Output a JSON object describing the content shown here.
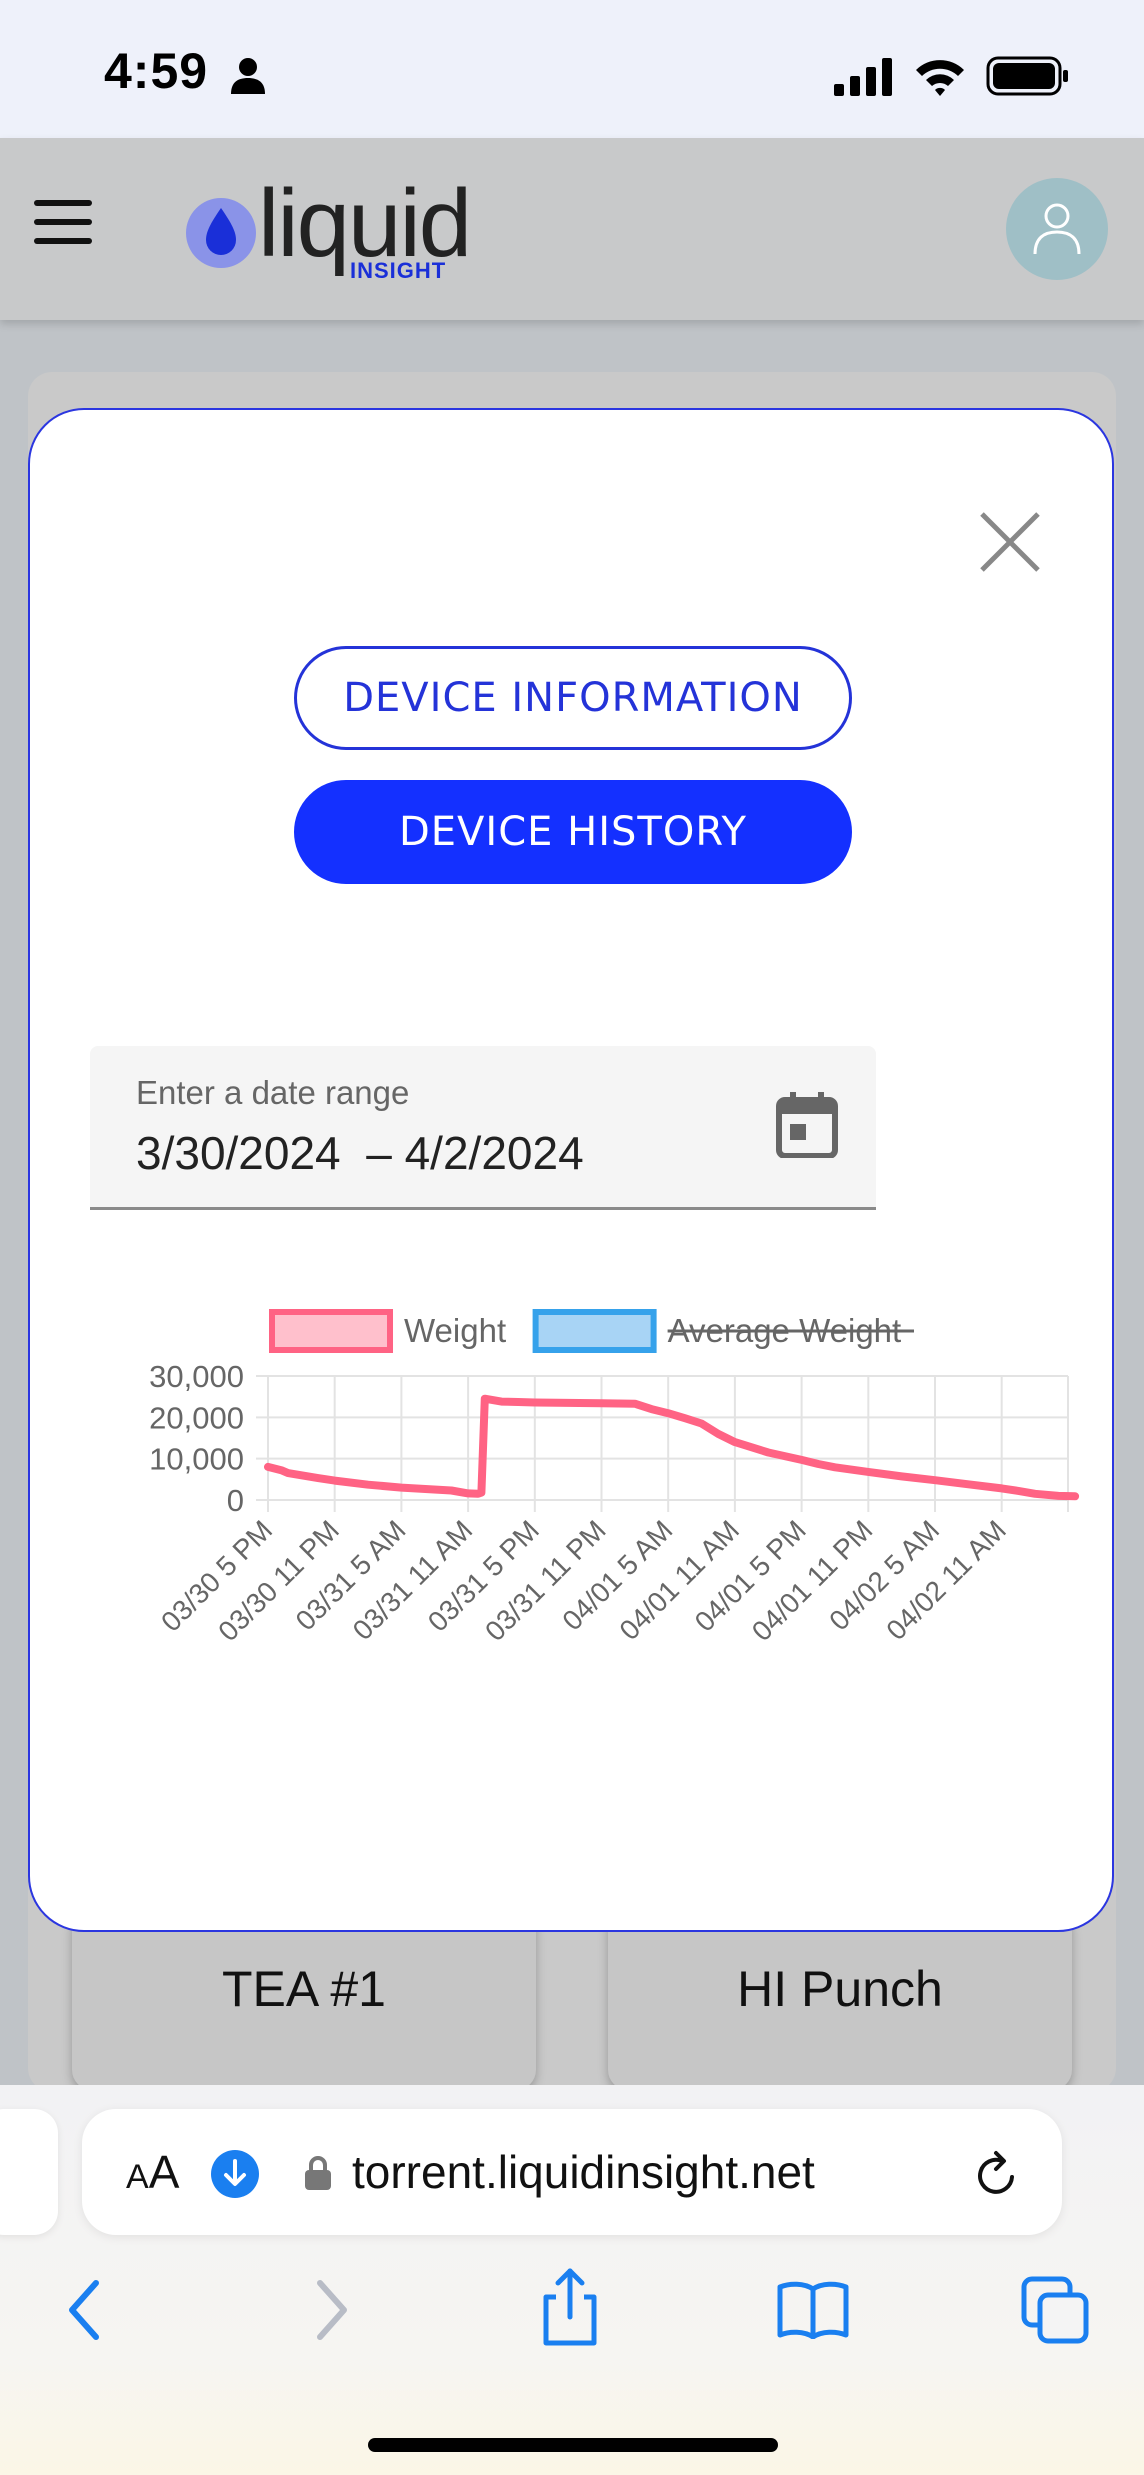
{
  "status_bar": {
    "time": "4:59"
  },
  "header": {
    "logo_word": "liquid",
    "logo_sub": "INSIGHT"
  },
  "background": {
    "product_cards": [
      "TEA #1",
      "HI Punch"
    ]
  },
  "modal": {
    "tabs": {
      "info": "DEVICE INFORMATION",
      "history": "DEVICE HISTORY"
    },
    "date_range": {
      "label": "Enter a date range",
      "start": "3/30/2024",
      "separator": "–",
      "end": "4/2/2024"
    }
  },
  "chart_data": {
    "type": "line",
    "series": [
      {
        "name": "Weight",
        "color": "#ff6384",
        "fill": "#ffc0cc",
        "hidden": false,
        "x": [
          0.0,
          0.4,
          0.6,
          1.5,
          2.0,
          3.0,
          4.0,
          5.5,
          6.0,
          6.3,
          6.4,
          6.5,
          7.0,
          7.5,
          8.0,
          9.0,
          10.0,
          11.0,
          11.5,
          12.0,
          12.5,
          13.0,
          13.5,
          14.0,
          15.0,
          16.0,
          16.5,
          17.0,
          18.0,
          19.0,
          20.0,
          21.0,
          22.0,
          22.5,
          23.0,
          23.7,
          24.2
        ],
        "y": [
          8000,
          7200,
          6500,
          5300,
          4700,
          3700,
          3000,
          2300,
          1600,
          1500,
          1800,
          24500,
          23800,
          23700,
          23600,
          23500,
          23400,
          23300,
          22000,
          21000,
          19800,
          18500,
          16000,
          14000,
          11500,
          9700,
          8700,
          7900,
          6800,
          5700,
          4800,
          3800,
          2800,
          2200,
          1500,
          1000,
          900
        ]
      },
      {
        "name": "Average Weight",
        "color": "#36a2eb",
        "fill": "#a8d4f5",
        "hidden": true,
        "x": [],
        "y": []
      }
    ],
    "x_ticks": [
      "03/30 5 PM",
      "03/30 11 PM",
      "03/31 5 AM",
      "03/31 11 AM",
      "03/31 5 PM",
      "03/31 11 PM",
      "04/01 5 AM",
      "04/01 11 AM",
      "04/01 5 PM",
      "04/01 11 PM",
      "04/02 5 AM",
      "04/02 11 AM"
    ],
    "y_ticks": [
      "30,000",
      "20,000",
      "10,000",
      "0"
    ],
    "y_values": [
      30000,
      20000,
      10000,
      0
    ],
    "ylim": [
      0,
      30000
    ],
    "xlim": [
      0,
      24.5
    ],
    "grid": true,
    "legend": "top"
  },
  "browser": {
    "aa_small": "A",
    "aa_large": "A",
    "url": "torrent.liquidinsight.net"
  },
  "colors": {
    "accent": "#1430ff",
    "line": "#ff6384"
  }
}
